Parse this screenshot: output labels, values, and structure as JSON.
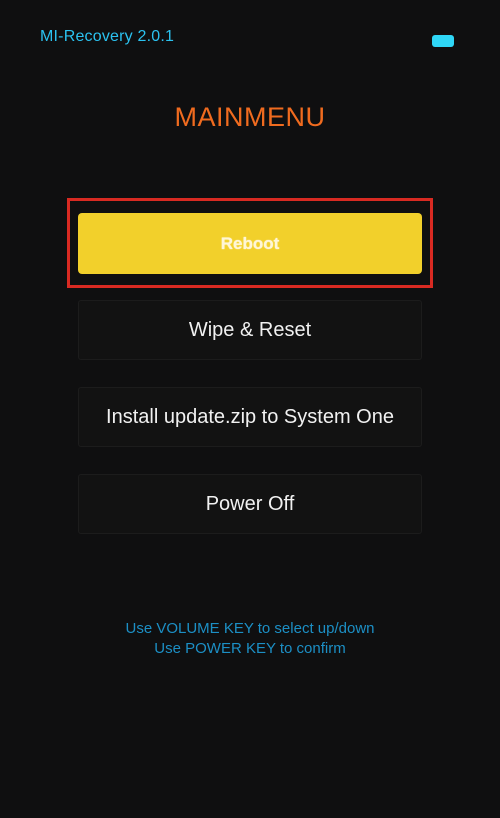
{
  "status_bar": {
    "version": "MI-Recovery 2.0.1",
    "battery_icon": "battery-icon",
    "battery_color": "#2fd7f7"
  },
  "title": "MAINMENU",
  "menu": {
    "items": [
      {
        "label": "Reboot",
        "selected": true
      },
      {
        "label": "Wipe & Reset",
        "selected": false
      },
      {
        "label": "Install update.zip to System One",
        "selected": false
      },
      {
        "label": "Power Off",
        "selected": false
      }
    ]
  },
  "hints": {
    "line1": "Use VOLUME KEY to select up/down",
    "line2": "Use POWER KEY to confirm"
  },
  "colors": {
    "accent_title": "#f06b1f",
    "selected_bg": "#f2d02b",
    "highlight_border": "#d82a22",
    "hint": "#1c8fc5"
  }
}
